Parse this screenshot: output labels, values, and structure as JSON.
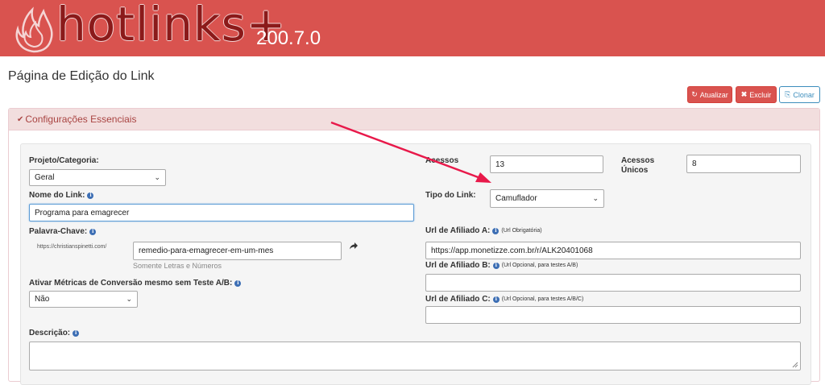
{
  "header": {
    "logo_text": "hotlinks+",
    "version": "200.7.0"
  },
  "page": {
    "title": "Página de Edição do Link"
  },
  "toolbar": {
    "update_label": "Atualizar",
    "delete_label": "Excluir",
    "clone_label": "Clonar"
  },
  "panel": {
    "title": "Configurações Essenciais"
  },
  "form": {
    "project_label": "Projeto/Categoria:",
    "project_value": "Geral",
    "link_name_label": "Nome do Link:",
    "link_name_value": "Programa para emagrecer",
    "keyword_label": "Palavra-Chave:",
    "keyword_prefix": "https://christianspinetti.com/",
    "keyword_value": "remedio-para-emagrecer-em-um-mes",
    "keyword_hint": "Somente Letras e Números",
    "metrics_label": "Ativar Métricas de Conversão mesmo sem Teste A/B:",
    "metrics_value": "Não",
    "description_label": "Descrição:",
    "description_value": "",
    "access_label": "Acessos",
    "access_value": "13",
    "unique_access_label_1": "Acessos",
    "unique_access_label_2": "Únicos",
    "unique_access_value": "8",
    "link_type_label": "Tipo do Link:",
    "link_type_value": "Camuflador",
    "affiliate_a_label": "Url de Afiliado A:",
    "affiliate_a_note": "(Url Obrigatória)",
    "affiliate_a_value": "https://app.monetizze.com.br/r/ALK20401068",
    "affiliate_b_label": "Url de Afiliado B:",
    "affiliate_b_note": "(Url Opcional, para testes A/B)",
    "affiliate_b_value": "",
    "affiliate_c_label": "Url de Afiliado C:",
    "affiliate_c_note": "(Url Opcional, para testes A/B/C)",
    "affiliate_c_value": ""
  },
  "colors": {
    "header_bg": "#d9534f",
    "logo_text": "#8b1a1a",
    "panel_head_bg": "#f2dede",
    "panel_head_text": "#a94442",
    "annotation_arrow": "#e8194a",
    "info_icon": "#3c6eb4"
  }
}
